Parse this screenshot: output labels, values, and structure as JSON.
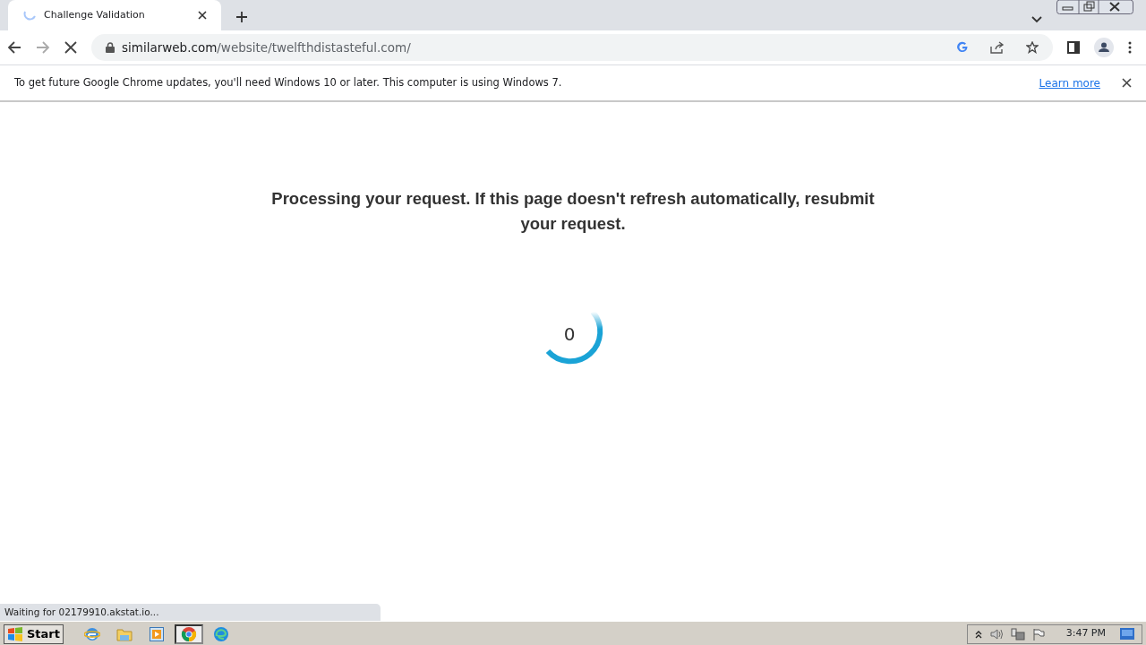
{
  "tab": {
    "title": "Challenge Validation"
  },
  "address": {
    "host": "similarweb.com",
    "path": "/website/twelfthdistasteful.com/"
  },
  "infobar": {
    "message": "To get future Google Chrome updates, you'll need Windows 10 or later. This computer is using Windows 7.",
    "link": "Learn more"
  },
  "page": {
    "heading": "Processing your request. If this page doesn't refresh automatically, resubmit your request.",
    "counter": "0"
  },
  "status_bubble": "Waiting for 02179910.akstat.io...",
  "taskbar": {
    "start": "Start",
    "apps": [
      {
        "kind": "ie",
        "selected": false
      },
      {
        "kind": "folder",
        "selected": false
      },
      {
        "kind": "media",
        "selected": false
      },
      {
        "kind": "chrome",
        "selected": true
      },
      {
        "kind": "edge",
        "selected": false
      }
    ],
    "clock": "3:47 PM"
  }
}
